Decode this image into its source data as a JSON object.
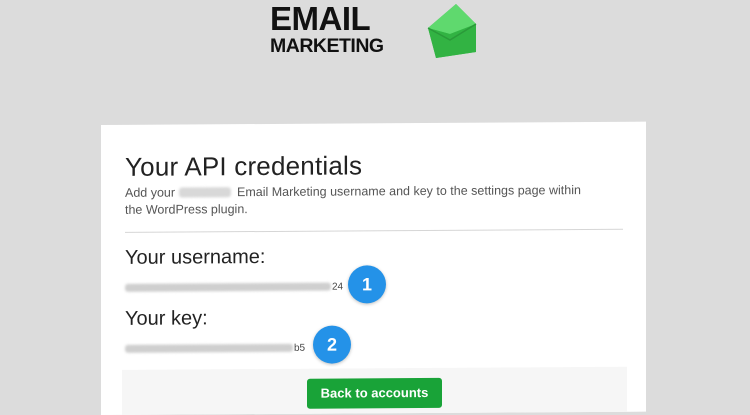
{
  "logo": {
    "line1": "EMAIL",
    "line2": "MARKETING"
  },
  "credentials": {
    "title": "Your API credentials",
    "description_before": "Add your",
    "description_after": "Email Marketing username and key to the settings page within the WordPress plugin.",
    "username_label": "Your username:",
    "username_visible_suffix": "24",
    "key_label": "Your key:",
    "key_visible_suffix": "b5"
  },
  "annotations": {
    "badge_1": "1",
    "badge_2": "2"
  },
  "footer": {
    "back_button_label": "Back to accounts"
  },
  "colors": {
    "background": "#dcdcdc",
    "card": "#ffffff",
    "button_green": "#19a338",
    "badge_blue": "#2492e8",
    "logo_green": "#3cc54e"
  }
}
